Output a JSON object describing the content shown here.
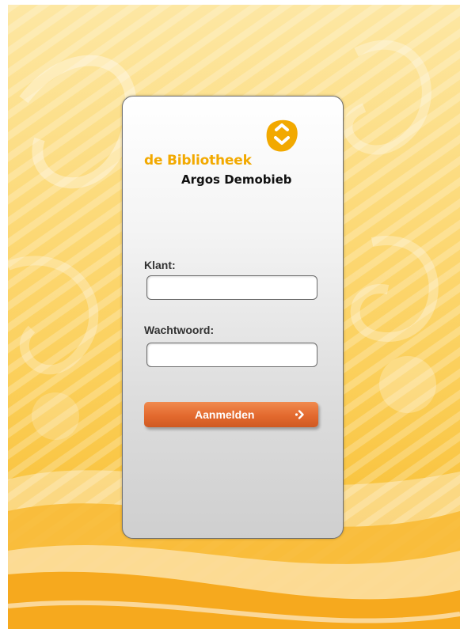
{
  "brand": {
    "name": "de Bibliotheek",
    "branch": "Argos Demobieb",
    "logo_icon": "bibliotheek-logo-icon",
    "accent": "#f2a900"
  },
  "form": {
    "customer_label": "Klant:",
    "customer_value": "",
    "password_label": "Wachtwoord:",
    "password_value": "",
    "submit_label": "Aanmelden",
    "submit_icon": "chevron-right-icon",
    "submit_color": "#e3692e"
  }
}
